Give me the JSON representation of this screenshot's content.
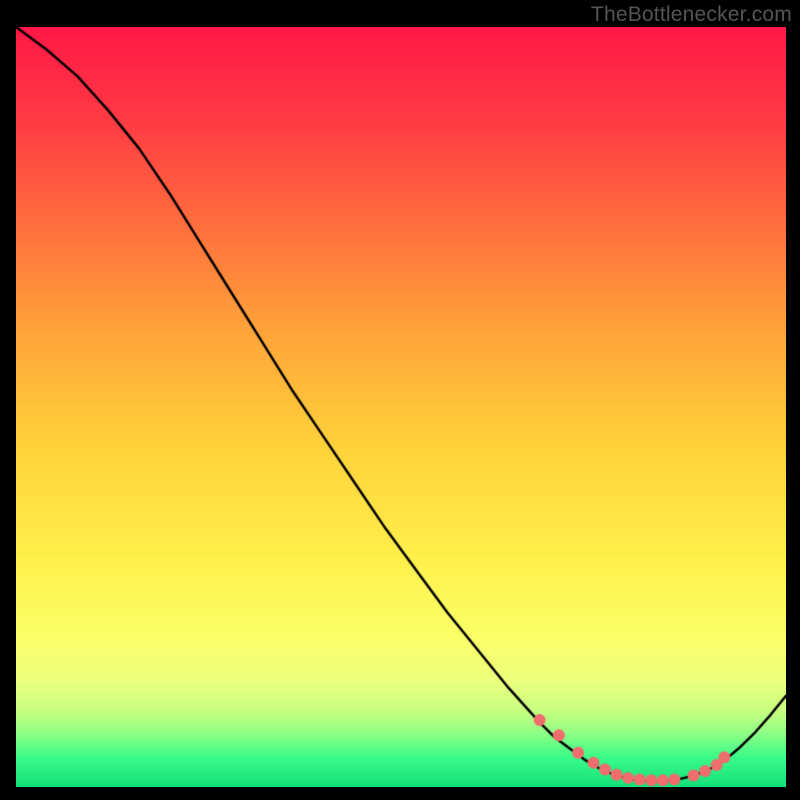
{
  "watermark": "TheBottlenecker.com",
  "chart_data": {
    "type": "line",
    "title": "",
    "xlabel": "",
    "ylabel": "",
    "xlim": [
      0,
      100
    ],
    "ylim": [
      0,
      100
    ],
    "background_gradient_stops": [
      {
        "pos": 0.0,
        "color": "#ff1846"
      },
      {
        "pos": 0.12,
        "color": "#ff3a44"
      },
      {
        "pos": 0.25,
        "color": "#ff6a3e"
      },
      {
        "pos": 0.4,
        "color": "#ffa439"
      },
      {
        "pos": 0.55,
        "color": "#ffd23a"
      },
      {
        "pos": 0.7,
        "color": "#fff04a"
      },
      {
        "pos": 0.8,
        "color": "#fcff68"
      },
      {
        "pos": 0.86,
        "color": "#ecff7d"
      },
      {
        "pos": 0.9,
        "color": "#c8ff80"
      },
      {
        "pos": 0.93,
        "color": "#8dff86"
      },
      {
        "pos": 0.96,
        "color": "#3bfc88"
      },
      {
        "pos": 1.0,
        "color": "#14e07a"
      }
    ],
    "series": [
      {
        "name": "curve",
        "x": [
          0,
          4,
          8,
          12,
          16,
          20,
          24,
          28,
          32,
          36,
          40,
          44,
          48,
          52,
          56,
          60,
          64,
          68,
          70,
          72,
          74,
          76,
          78,
          80,
          82,
          84,
          86,
          88,
          90,
          92,
          94,
          96,
          98,
          100
        ],
        "y": [
          100,
          97,
          93.5,
          89,
          84,
          78,
          71.5,
          65,
          58.5,
          52,
          46,
          40,
          34,
          28.5,
          23,
          18,
          13,
          8.5,
          6.5,
          5,
          3.5,
          2.3,
          1.5,
          1,
          0.8,
          0.8,
          1,
          1.5,
          2.3,
          3.5,
          5.2,
          7.2,
          9.5,
          12
        ]
      }
    ],
    "markers": {
      "name": "highlight-points",
      "color": "#ef6d6d",
      "radius_px": 6,
      "x": [
        68,
        70.5,
        73,
        75,
        76.5,
        78,
        79.5,
        81,
        82.5,
        84,
        85.5,
        88,
        89.5,
        91,
        92
      ],
      "y": [
        8.8,
        6.8,
        4.5,
        3.2,
        2.3,
        1.6,
        1.2,
        1.0,
        0.9,
        0.9,
        1.0,
        1.5,
        2.1,
        2.9,
        3.9
      ]
    }
  }
}
